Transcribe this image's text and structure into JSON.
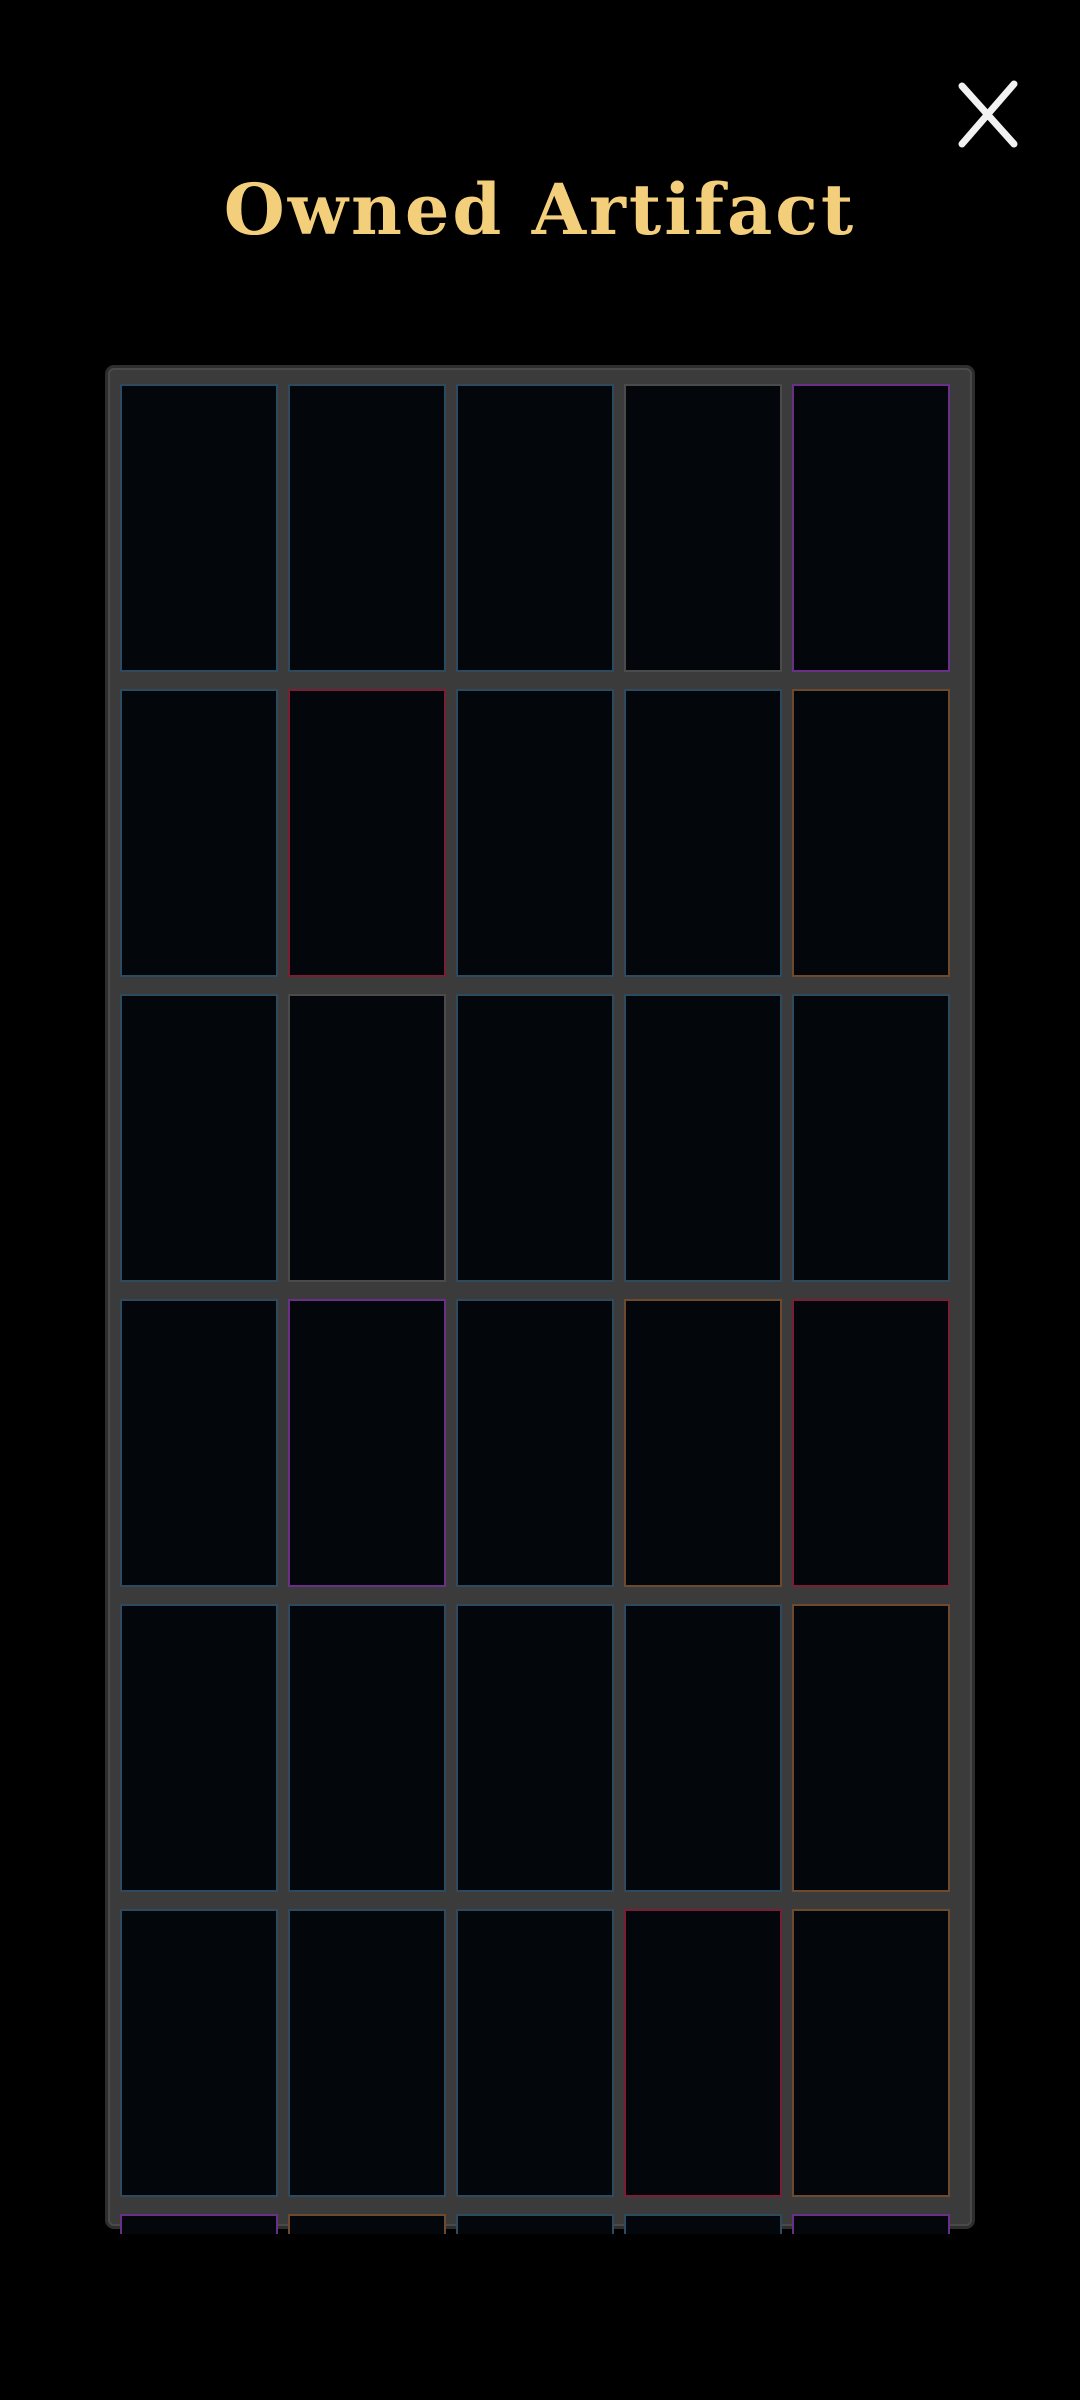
{
  "header": {
    "title": "Owned Artifact",
    "close_label": "X"
  },
  "artifacts": [
    {
      "icon": "lantern-icon",
      "border": "blue"
    },
    {
      "icon": "music-notes-icon",
      "border": "blue"
    },
    {
      "icon": "teal-crystal-icon",
      "border": "blue"
    },
    {
      "icon": "purple-diamond-icon",
      "border": "gray"
    },
    {
      "icon": "circuit-icon",
      "border": "purple"
    },
    {
      "icon": "pentagram-book-icon",
      "border": "blue"
    },
    {
      "icon": "cracked-lines-icon",
      "border": "red"
    },
    {
      "icon": "leather-pouch-icon",
      "border": "blue"
    },
    {
      "icon": "gray-claw-icon",
      "border": "blue"
    },
    {
      "icon": "red-star-icon",
      "border": "brown"
    },
    {
      "icon": "potion-flask-icon",
      "border": "blue"
    },
    {
      "icon": "crow-icon",
      "border": "gray"
    },
    {
      "icon": "rose-mask-icon",
      "border": "blue"
    },
    {
      "icon": "bomb-icon",
      "border": "blue"
    },
    {
      "icon": "radar-icon",
      "border": "blue"
    },
    {
      "icon": "target-icon",
      "border": "blue"
    },
    {
      "icon": "tarot-cards-icon",
      "border": "purple"
    },
    {
      "icon": "hourglass-icon",
      "border": "blue"
    },
    {
      "icon": "scythe-icon",
      "border": "brown"
    },
    {
      "icon": "hydra-icon",
      "border": "red"
    },
    {
      "icon": "wizard-hat-icon",
      "border": "blue"
    },
    {
      "icon": "blue-orb-icon",
      "border": "blue"
    },
    {
      "icon": "wind-swirl-icon",
      "border": "blue"
    },
    {
      "icon": "snowman-icon",
      "border": "blue"
    },
    {
      "icon": "golden-fur-icon",
      "border": "brown"
    },
    {
      "icon": "rose-icon",
      "border": "blue"
    },
    {
      "icon": "blood-bag-icon",
      "border": "blue"
    },
    {
      "icon": "dagger-icon",
      "border": "blue"
    },
    {
      "icon": "roulette-icon",
      "border": "red"
    },
    {
      "icon": "radiation-icon",
      "border": "brown"
    },
    {
      "icon": "hidden-artifact-icon",
      "border": "purple"
    },
    {
      "icon": "hidden-artifact-icon",
      "border": "brown"
    },
    {
      "icon": "hidden-artifact-icon",
      "border": "blue"
    },
    {
      "icon": "hidden-artifact-icon",
      "border": "blue"
    },
    {
      "icon": "hidden-artifact-icon",
      "border": "purple"
    }
  ]
}
